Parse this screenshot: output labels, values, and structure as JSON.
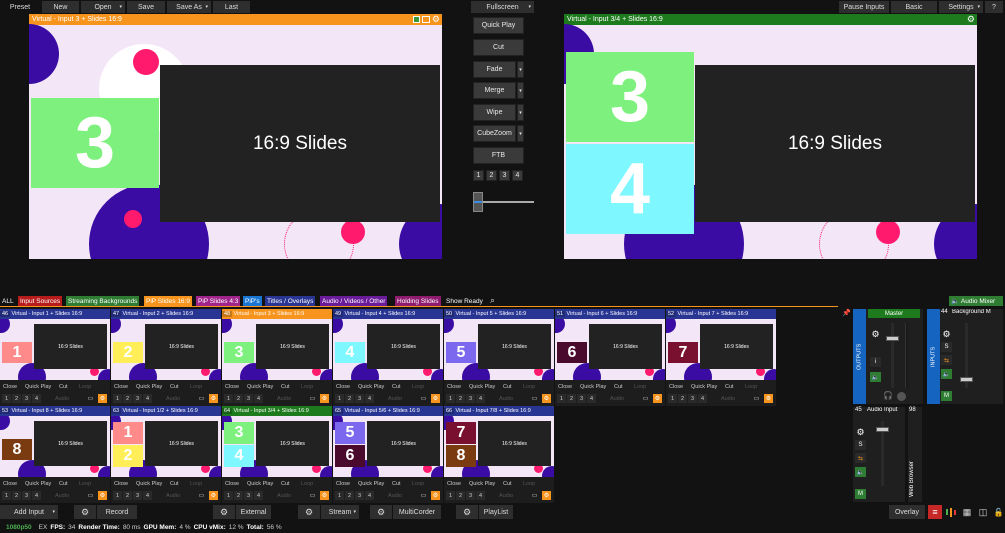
{
  "toolbar": {
    "preset": "Preset",
    "new": "New",
    "open": "Open",
    "save": "Save",
    "save_as": "Save As",
    "last": "Last",
    "fullscreen": "Fullscreen",
    "pause_inputs": "Pause Inputs",
    "basic": "Basic",
    "settings": "Settings",
    "help": "?"
  },
  "preview": {
    "title": "Virtual - Input 3 + Slides 16:9",
    "slide_text": "16:9 Slides",
    "number": "3",
    "header_color": "#f7941d"
  },
  "output": {
    "title": "Virtual - Input 3/4 + Slides 16:9",
    "slide_text": "16:9 Slides",
    "num_top": "3",
    "num_bottom": "4",
    "header_color": "#1d7a1d"
  },
  "transitions": {
    "quick_play": "Quick Play",
    "cut": "Cut",
    "fade": "Fade",
    "merge": "Merge",
    "wipe": "Wipe",
    "cubezoom": "CubeZoom",
    "ftb": "FTB",
    "numbers": [
      "1",
      "2",
      "3",
      "4"
    ]
  },
  "tabs": [
    {
      "label": "ALL",
      "color": "#121212"
    },
    {
      "label": "Input Sources",
      "color": "#b71c1c"
    },
    {
      "label": "Streaming Backgrounds",
      "color": "#2e7d32"
    },
    {
      "label": "PiP Slides 16:9",
      "color": "#f7941d"
    },
    {
      "label": "PiP Slides 4:3",
      "color": "#a0248a"
    },
    {
      "label": "PiP's",
      "color": "#1976d2"
    },
    {
      "label": "Titles / Overlays",
      "color": "#283593"
    },
    {
      "label": "Audio / Videos / Other",
      "color": "#6a1b9a"
    },
    {
      "label": "Holding Slides",
      "color": "#8e1b6e"
    },
    {
      "label": "Show Ready",
      "color": "#121212"
    }
  ],
  "audio_mixer_label": "Audio Mixer",
  "inputs": [
    {
      "num": "46",
      "title": "Virtual - Input 1 + Slides 16:9",
      "head": "#283593",
      "digits": [
        "1"
      ],
      "colors": [
        "#ff8a8a"
      ],
      "slide": "16:9 Slides"
    },
    {
      "num": "47",
      "title": "Virtual - Input 2 + Slides 16:9",
      "head": "#283593",
      "digits": [
        "2"
      ],
      "colors": [
        "#ffee58"
      ],
      "slide": "16:9 Slides"
    },
    {
      "num": "48",
      "title": "Virtual - Input 3 + Slides 16:9",
      "head": "#f7941d",
      "digits": [
        "3"
      ],
      "colors": [
        "#7ef07e"
      ],
      "slide": "16:9 Slides"
    },
    {
      "num": "49",
      "title": "Virtual - Input 4 + Slides 16:9",
      "head": "#283593",
      "digits": [
        "4"
      ],
      "colors": [
        "#7ff7ff"
      ],
      "slide": "16:9 Slides"
    },
    {
      "num": "50",
      "title": "Virtual - Input 5 + Slides 16:9",
      "head": "#283593",
      "digits": [
        "5"
      ],
      "colors": [
        "#7b68ee"
      ],
      "slide": "16:9 Slides"
    },
    {
      "num": "51",
      "title": "Virtual - Input 6 + Slides 16:9",
      "head": "#283593",
      "digits": [
        "6"
      ],
      "colors": [
        "#4a0a2e"
      ],
      "slide": "16:9 Slides"
    },
    {
      "num": "52",
      "title": "Virtual - Input 7 + Slides 16:9",
      "head": "#283593",
      "digits": [
        "7"
      ],
      "colors": [
        "#7a1030"
      ],
      "slide": "16:9 Slides"
    },
    {
      "num": "53",
      "title": "Virtual - Input 8 + Slides 16:9",
      "head": "#283593",
      "digits": [
        "8"
      ],
      "colors": [
        "#7a3b10"
      ],
      "slide": "16:9 Slides"
    },
    {
      "num": "63",
      "title": "Virtual - Input 1/2 + Slides 16:9",
      "head": "#283593",
      "digits": [
        "1",
        "2"
      ],
      "colors": [
        "#ff8a8a",
        "#ffee58"
      ],
      "slide": "16:9 Slides"
    },
    {
      "num": "64",
      "title": "Virtual - Input 3/4 + Slides 16:9",
      "head": "#1d7a1d",
      "digits": [
        "3",
        "4"
      ],
      "colors": [
        "#7ef07e",
        "#7ff7ff"
      ],
      "slide": "16:9 Slides"
    },
    {
      "num": "65",
      "title": "Virtual - Input 5/6 + Slides 16:9",
      "head": "#283593",
      "digits": [
        "5",
        "6"
      ],
      "colors": [
        "#7b68ee",
        "#4a0a2e"
      ],
      "slide": "16:9 Slides"
    },
    {
      "num": "66",
      "title": "Virtual - Input 7/8 + Slides 16:9",
      "head": "#283593",
      "digits": [
        "7",
        "8"
      ],
      "colors": [
        "#7a1030",
        "#7a3b10"
      ],
      "slide": "16:9 Slides"
    }
  ],
  "tile_controls": {
    "close": "Close",
    "quick_play": "Quick Play",
    "cut": "Cut",
    "loop": "Loop",
    "audio": "Audio",
    "numbers": [
      "1",
      "2",
      "3",
      "4"
    ]
  },
  "mixer": {
    "master": "Master",
    "outputs": "OUTPUTS",
    "inputs": "INPUTS",
    "bg_num": "44",
    "bg_label": "Background M",
    "ai_num": "45",
    "ai_label": "Audio Input",
    "wb_num": "98",
    "wb_label": "Web Browser",
    "s": "S",
    "m": "M"
  },
  "bottom": {
    "add_input": "Add Input",
    "record": "Record",
    "external": "External",
    "stream": "Stream",
    "multicorder": "MultiCorder",
    "playlist": "PlayList",
    "overlay": "Overlay"
  },
  "status": {
    "res": "1080p50",
    "ex": "EX",
    "fps_label": "FPS:",
    "fps": "34",
    "render_label": "Render Time:",
    "render": "80 ms",
    "gpu_label": "GPU Mem:",
    "gpu": "4 %",
    "cpu_label": "CPU vMix:",
    "cpu": "12 %",
    "total_label": "Total:",
    "total": "56 %"
  }
}
